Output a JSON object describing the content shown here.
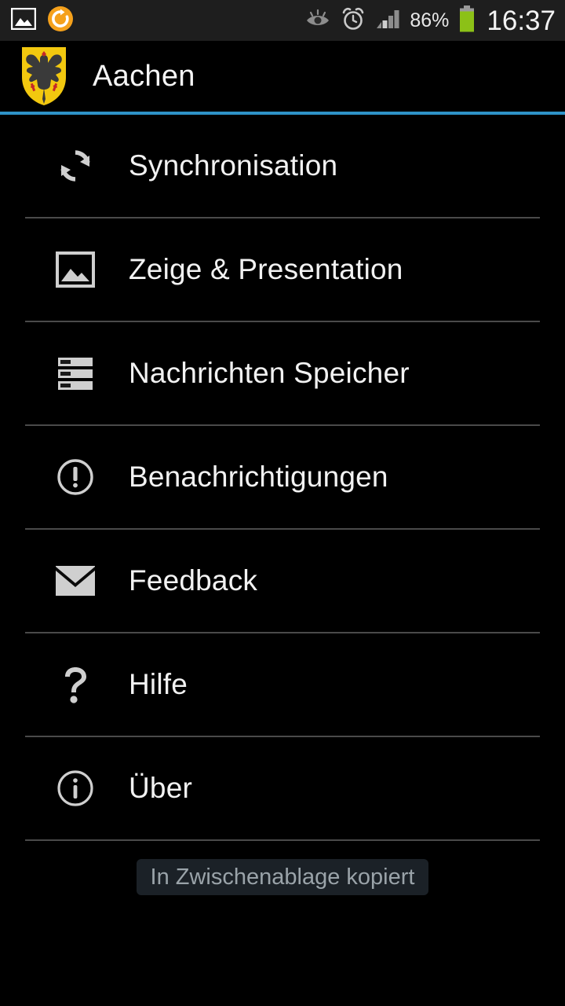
{
  "status_bar": {
    "left_icons": [
      {
        "name": "gallery-image-icon",
        "label": "Gallery"
      },
      {
        "name": "sync-circle-orange-icon",
        "label": "Sync"
      }
    ],
    "right_icons": [
      {
        "name": "smart-stay-eye-icon",
        "label": "Smart stay"
      },
      {
        "name": "alarm-clock-icon",
        "label": "Alarm set"
      },
      {
        "name": "signal-bars-icon",
        "label": "Signal"
      }
    ],
    "battery_percent": "86%",
    "battery_icon": "battery-icon",
    "clock": "16:37",
    "battery_color": "#8cc117",
    "background": "#1e1e1e"
  },
  "action_bar": {
    "logo_icon": "aachen-coat-of-arms-icon",
    "title": "Aachen",
    "accent_color": "#2e93c8"
  },
  "settings": {
    "items": [
      {
        "icon": "sync-refresh-icon",
        "label": "Synchronisation"
      },
      {
        "icon": "image-picture-icon",
        "label": "Zeige & Presentation"
      },
      {
        "icon": "storage-bars-icon",
        "label": "Nachrichten Speicher"
      },
      {
        "icon": "alert-exclamation-icon",
        "label": "Benachrichtigungen"
      },
      {
        "icon": "envelope-mail-icon",
        "label": "Feedback"
      },
      {
        "icon": "question-mark-icon",
        "label": "Hilfe"
      },
      {
        "icon": "info-circle-icon",
        "label": "Über"
      }
    ]
  },
  "toast": {
    "message": "In Zwischenablage kopiert",
    "background": "#1b2127",
    "text_color": "#9aa3a9"
  }
}
